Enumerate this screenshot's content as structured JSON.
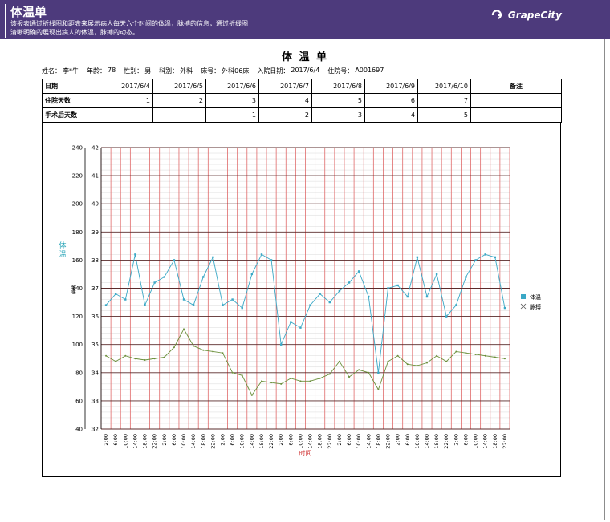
{
  "banner": {
    "title": "体温单",
    "description": "该报表通过折线图和距表来展示病人每天六个时间的体温，脉搏的信息，通过折线图清晰明确的展现出病人的体温，脉搏的动态。",
    "logo_text": "GrapeCity"
  },
  "report": {
    "title": "体 温 单",
    "patient": [
      {
        "label": "姓名：",
        "value": "李*牛"
      },
      {
        "label": "年龄：",
        "value": "78"
      },
      {
        "label": "性别：",
        "value": "男"
      },
      {
        "label": "科别：",
        "value": "外科"
      },
      {
        "label": "床号：",
        "value": "外科06床"
      },
      {
        "label": "入院日期：",
        "value": "2017/6/4"
      },
      {
        "label": "住院号：",
        "value": "A001697"
      }
    ],
    "table": {
      "rows": [
        {
          "label": "日期",
          "cells": [
            "2017/6/4",
            "2017/6/5",
            "2017/6/6",
            "2017/6/7",
            "2017/6/8",
            "2017/6/9",
            "2017/6/10"
          ],
          "note": "备注"
        },
        {
          "label": "住院天数",
          "cells": [
            "1",
            "2",
            "3",
            "4",
            "5",
            "6",
            "7"
          ],
          "note": ""
        },
        {
          "label": "手术后天数",
          "cells": [
            "",
            "",
            "1",
            "2",
            "3",
            "4",
            "5"
          ],
          "note": ""
        }
      ]
    }
  },
  "chart_data": {
    "type": "line",
    "xlabel": "时间",
    "ylabel_temp": "体温",
    "ylabel_pulse": "脉搏",
    "y_pulse_ticks": [
      40,
      60,
      80,
      100,
      120,
      140,
      160,
      180,
      200,
      220,
      240
    ],
    "y_temp_ticks": [
      32,
      33,
      34,
      35,
      36,
      37,
      38,
      39,
      40,
      41,
      42
    ],
    "x": [
      "2:00",
      "6:00",
      "10:00",
      "14:00",
      "18:00",
      "22:00",
      "2:00",
      "6:00",
      "10:00",
      "14:00",
      "18:00",
      "22:00",
      "2:00",
      "6:00",
      "10:00",
      "14:00",
      "18:00",
      "22:00",
      "2:00",
      "6:00",
      "10:00",
      "14:00",
      "18:00",
      "22:00",
      "2:00",
      "6:00",
      "10:00",
      "14:00",
      "18:00",
      "22:00",
      "2:00",
      "6:00",
      "10:00",
      "14:00",
      "18:00",
      "22:00",
      "2:00",
      "6:00",
      "10:00",
      "14:00",
      "18:00",
      "22:00"
    ],
    "legend": [
      {
        "name": "体温",
        "marker": "square",
        "color": "#3aa8c6"
      },
      {
        "name": "脉搏",
        "marker": "x",
        "color": "#6a8f3a"
      }
    ],
    "series": [
      {
        "name": "体温",
        "axis": "temp",
        "color": "#3aa8c6",
        "values": [
          36.4,
          36.8,
          36.6,
          38.2,
          36.4,
          37.2,
          37.4,
          38.0,
          36.6,
          36.4,
          37.4,
          38.1,
          36.4,
          36.6,
          36.3,
          37.5,
          38.2,
          38.0,
          35.0,
          35.8,
          35.6,
          36.4,
          36.8,
          36.5,
          36.9,
          37.2,
          37.6,
          36.7,
          34.0,
          37.0,
          37.1,
          36.7,
          38.1,
          36.7,
          37.5,
          36.0,
          36.4,
          37.4,
          38.0,
          38.2,
          38.1,
          36.3
        ]
      },
      {
        "name": "脉搏",
        "axis": "pulse",
        "color": "#6a8f3a",
        "values": [
          92,
          88,
          92,
          90,
          89,
          90,
          91,
          98,
          111,
          99,
          96,
          95,
          94,
          80,
          78,
          64,
          74,
          73,
          72,
          76,
          74,
          74,
          76,
          79,
          88,
          77,
          82,
          80,
          68,
          88,
          92,
          86,
          85,
          87,
          92,
          88,
          95,
          94,
          93,
          92,
          91,
          90
        ]
      }
    ]
  }
}
